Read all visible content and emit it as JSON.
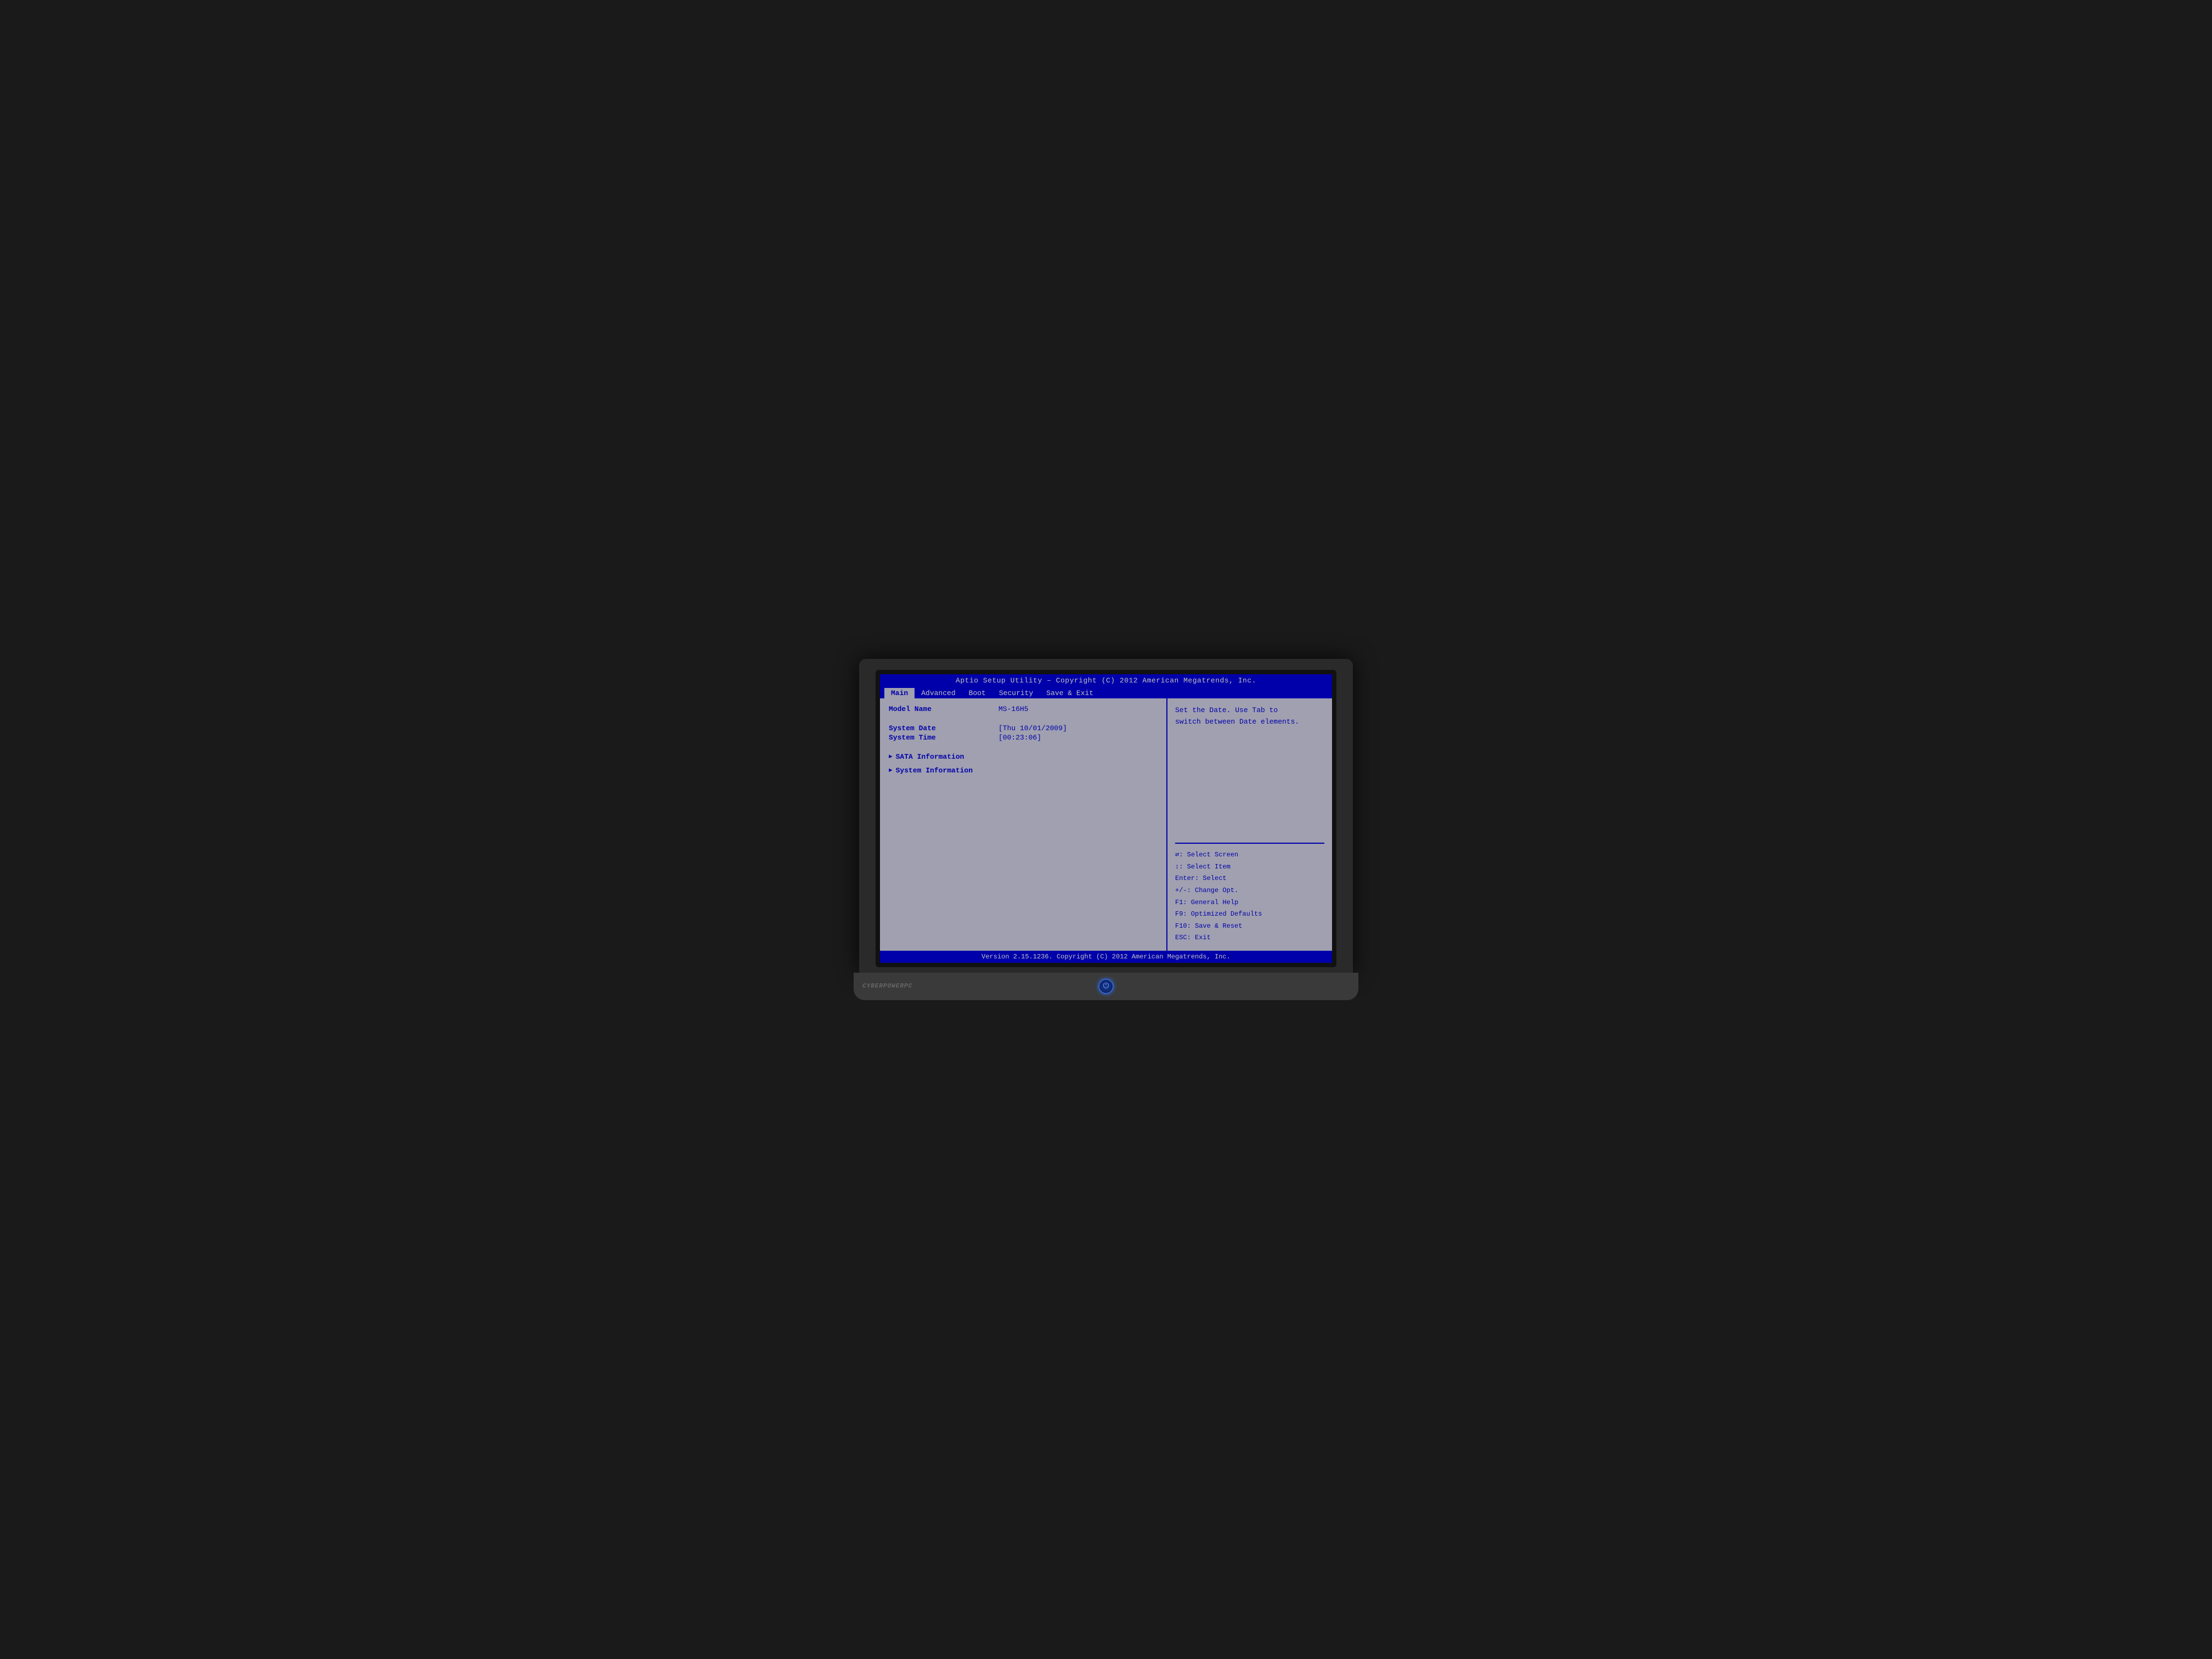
{
  "bios": {
    "title": "Aptio Setup Utility – Copyright (C) 2012 American Megatrends, Inc.",
    "footer": "Version 2.15.1236. Copyright (C) 2012 American Megatrends, Inc.",
    "nav": {
      "tabs": [
        {
          "label": "Main",
          "active": true
        },
        {
          "label": "Advanced",
          "active": false
        },
        {
          "label": "Boot",
          "active": false
        },
        {
          "label": "Security",
          "active": false
        },
        {
          "label": "Save & Exit",
          "active": false
        }
      ]
    },
    "main": {
      "model_label": "Model Name",
      "model_value": "MS-16H5",
      "system_date_label": "System Date",
      "system_date_value": "[Thu 10/01/2009]",
      "system_time_label": "System Time",
      "system_time_value": "[00:23:06]",
      "sata_label": "SATA Information",
      "system_info_label": "System Information"
    },
    "help": {
      "text": "Set the Date. Use Tab to\nswitch between Date elements."
    },
    "keys": {
      "lines": [
        "→←: Select Screen",
        "↑↓: Select Item",
        "Enter: Select",
        "+/-: Change Opt.",
        "F1: General Help",
        "F9: Optimized Defaults",
        "F10: Save & Reset",
        "ESC: Exit"
      ]
    }
  },
  "laptop": {
    "brand": "CYBERPOWERPC"
  }
}
